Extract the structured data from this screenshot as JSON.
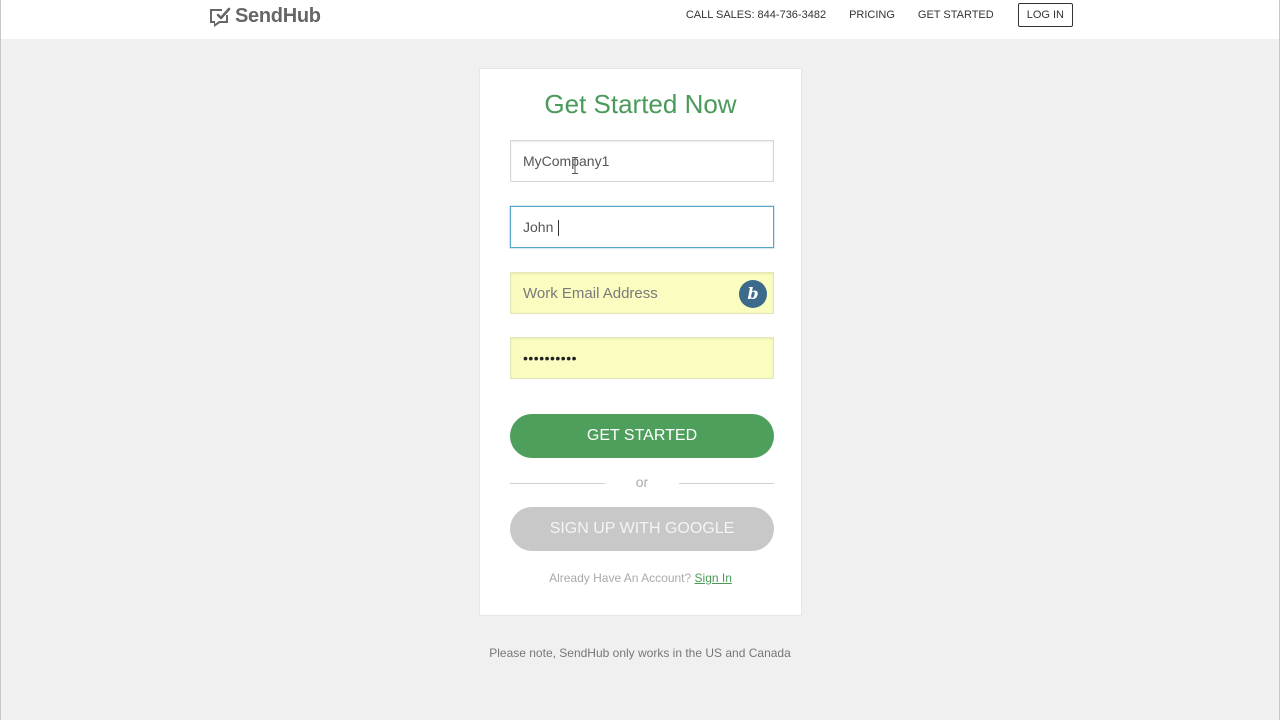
{
  "header": {
    "brand": "SendHub",
    "nav": {
      "call_sales": "CALL SALES: 844-736-3482",
      "pricing": "PRICING",
      "get_started": "GET STARTED",
      "login": "LOG IN"
    }
  },
  "form": {
    "title": "Get Started Now",
    "company_value": "MyCompany1",
    "name_value": "John ",
    "email_placeholder": "Work Email Address",
    "password_mask": "••••••••••",
    "submit_label": "GET STARTED",
    "or_label": "or",
    "google_label": "SIGN UP WITH GOOGLE",
    "account_prompt": "Already Have An Account?",
    "signin_label": "Sign In",
    "extension_badge": "b"
  },
  "footer": {
    "note": "Please note, SendHub only works in the US and Canada"
  },
  "colors": {
    "accent": "#4e9e5c",
    "title": "#4a9a5a",
    "autofill": "#fafcc0",
    "focus": "#5aa6c8",
    "google_button": "#c8c8c8",
    "badge": "#3b6a8a"
  },
  "icons": {
    "logo": "chat-bubble-check-icon",
    "text_cursor": "ibeam-cursor-icon",
    "extension": "bitwarden-b-icon"
  }
}
